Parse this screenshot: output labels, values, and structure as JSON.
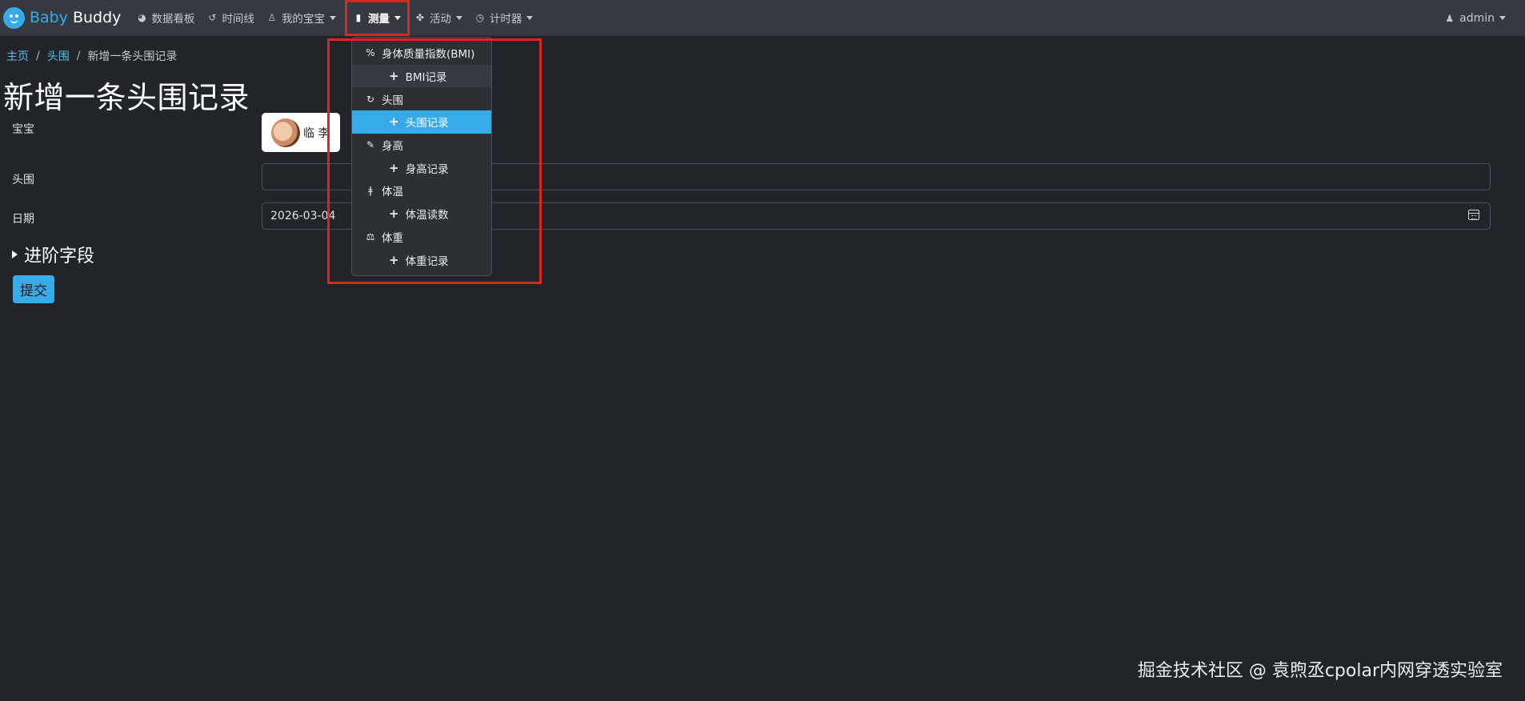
{
  "brand": {
    "part1": "Baby",
    "part2": "Buddy"
  },
  "nav": {
    "items": [
      {
        "label": "数据看板",
        "icon": "dashboard-icon"
      },
      {
        "label": "时间线",
        "icon": "history-icon"
      },
      {
        "label": "我的宝宝",
        "icon": "baby-icon"
      },
      {
        "label": "测量",
        "icon": "clipboard-icon"
      },
      {
        "label": "活动",
        "icon": "activities-icon"
      },
      {
        "label": "计时器",
        "icon": "timer-icon"
      }
    ],
    "user": "admin"
  },
  "breadcrumb": {
    "home": "主页",
    "section": "头围",
    "current": "新增一条头围记录"
  },
  "page_title": "新增一条头围记录",
  "form": {
    "child_label": "宝宝",
    "child_name": "临 李",
    "head_label": "头围",
    "head_value": "",
    "date_label": "日期",
    "date_value": "2026-03-04",
    "advanced_label": "进阶字段",
    "submit_label": "提交"
  },
  "dropdown": {
    "items": [
      {
        "type": "head",
        "label": "身体质量指数(BMI)",
        "icon": "percent-icon"
      },
      {
        "type": "sub",
        "label": "BMI记录",
        "icon": "plus-icon"
      },
      {
        "type": "head",
        "label": "头围",
        "icon": "refresh-icon"
      },
      {
        "type": "sub",
        "label": "头围记录",
        "icon": "plus-icon"
      },
      {
        "type": "head",
        "label": "身高",
        "icon": "ruler-icon"
      },
      {
        "type": "sub",
        "label": "身高记录",
        "icon": "plus-icon"
      },
      {
        "type": "head",
        "label": "体温",
        "icon": "thermometer-icon"
      },
      {
        "type": "sub",
        "label": "体温读数",
        "icon": "plus-icon"
      },
      {
        "type": "head",
        "label": "体重",
        "icon": "scale-icon"
      },
      {
        "type": "sub",
        "label": "体重记录",
        "icon": "plus-icon"
      }
    ]
  },
  "watermark": "掘金技术社区 @ 袁煦丞cpolar内网穿透实验室",
  "colors": {
    "accent": "#37abe9",
    "highlight": "#dc2626",
    "background": "#212529",
    "navbar": "#343a40"
  }
}
